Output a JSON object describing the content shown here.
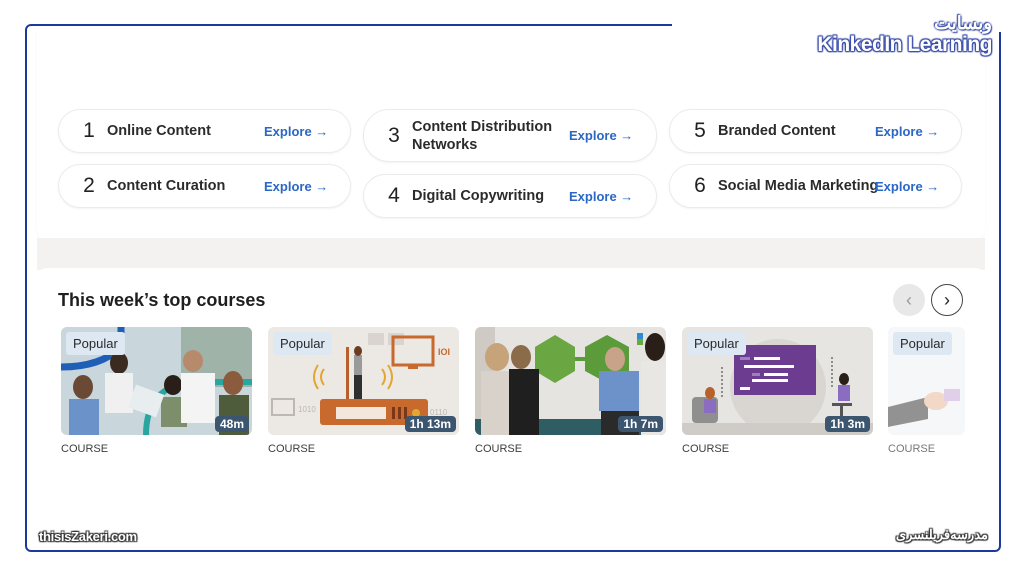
{
  "watermarks": {
    "top_fa": "وبسایت",
    "top_en": "KinkedIn Learning",
    "bottom_left": "thisisZakeri.com",
    "bottom_right": "مدرسه‌فریلنسری"
  },
  "topics": [
    {
      "number": "1",
      "label": "Online Content",
      "action": "Explore →"
    },
    {
      "number": "2",
      "label": "Content Curation",
      "action": "Explore →"
    },
    {
      "number": "3",
      "label": "Content Distribution Networks",
      "action": "Explore →"
    },
    {
      "number": "4",
      "label": "Digital Copywriting",
      "action": "Explore →"
    },
    {
      "number": "5",
      "label": "Branded Content",
      "action": "Explore →"
    },
    {
      "number": "6",
      "label": "Social Media Marketing",
      "action": "Explore →"
    }
  ],
  "top_courses": {
    "title": "This week’s top courses",
    "prev_icon": "‹",
    "next_icon": "›",
    "courses": [
      {
        "badge": "Popular",
        "duration": "48m",
        "type": "COURSE"
      },
      {
        "badge": "Popular",
        "duration": "1h 13m",
        "type": "COURSE"
      },
      {
        "badge": "",
        "duration": "1h 7m",
        "type": "COURSE"
      },
      {
        "badge": "Popular",
        "duration": "1h 3m",
        "type": "COURSE"
      },
      {
        "badge": "Popular",
        "duration": "",
        "type": "COURSE"
      }
    ]
  },
  "colors": {
    "frame": "#1d3a9a",
    "link": "#2b67c4",
    "duration_badge": "#3d5670",
    "popular_badge": "#dde8f2"
  }
}
